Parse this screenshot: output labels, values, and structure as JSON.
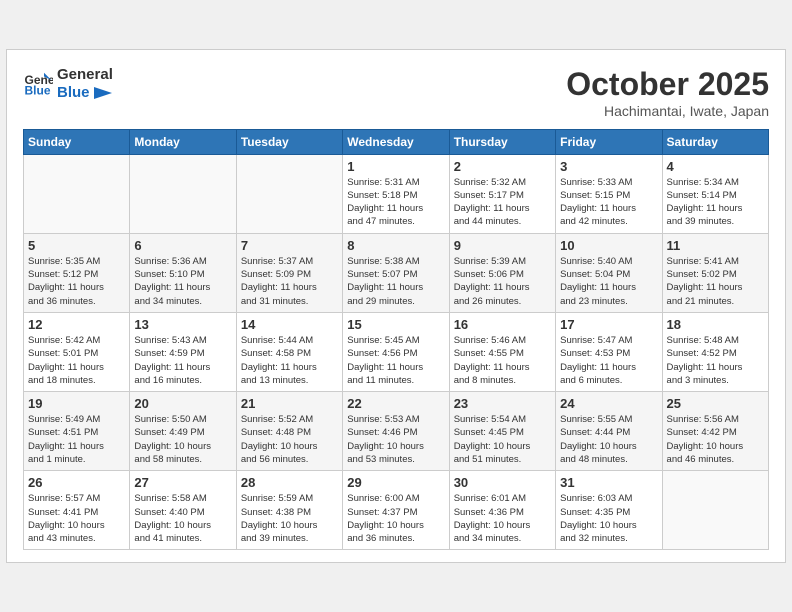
{
  "header": {
    "logo_line1": "General",
    "logo_line2": "Blue",
    "month_title": "October 2025",
    "location": "Hachimantai, Iwate, Japan"
  },
  "weekdays": [
    "Sunday",
    "Monday",
    "Tuesday",
    "Wednesday",
    "Thursday",
    "Friday",
    "Saturday"
  ],
  "weeks": [
    [
      {
        "day": "",
        "info": ""
      },
      {
        "day": "",
        "info": ""
      },
      {
        "day": "",
        "info": ""
      },
      {
        "day": "1",
        "info": "Sunrise: 5:31 AM\nSunset: 5:18 PM\nDaylight: 11 hours\nand 47 minutes."
      },
      {
        "day": "2",
        "info": "Sunrise: 5:32 AM\nSunset: 5:17 PM\nDaylight: 11 hours\nand 44 minutes."
      },
      {
        "day": "3",
        "info": "Sunrise: 5:33 AM\nSunset: 5:15 PM\nDaylight: 11 hours\nand 42 minutes."
      },
      {
        "day": "4",
        "info": "Sunrise: 5:34 AM\nSunset: 5:14 PM\nDaylight: 11 hours\nand 39 minutes."
      }
    ],
    [
      {
        "day": "5",
        "info": "Sunrise: 5:35 AM\nSunset: 5:12 PM\nDaylight: 11 hours\nand 36 minutes."
      },
      {
        "day": "6",
        "info": "Sunrise: 5:36 AM\nSunset: 5:10 PM\nDaylight: 11 hours\nand 34 minutes."
      },
      {
        "day": "7",
        "info": "Sunrise: 5:37 AM\nSunset: 5:09 PM\nDaylight: 11 hours\nand 31 minutes."
      },
      {
        "day": "8",
        "info": "Sunrise: 5:38 AM\nSunset: 5:07 PM\nDaylight: 11 hours\nand 29 minutes."
      },
      {
        "day": "9",
        "info": "Sunrise: 5:39 AM\nSunset: 5:06 PM\nDaylight: 11 hours\nand 26 minutes."
      },
      {
        "day": "10",
        "info": "Sunrise: 5:40 AM\nSunset: 5:04 PM\nDaylight: 11 hours\nand 23 minutes."
      },
      {
        "day": "11",
        "info": "Sunrise: 5:41 AM\nSunset: 5:02 PM\nDaylight: 11 hours\nand 21 minutes."
      }
    ],
    [
      {
        "day": "12",
        "info": "Sunrise: 5:42 AM\nSunset: 5:01 PM\nDaylight: 11 hours\nand 18 minutes."
      },
      {
        "day": "13",
        "info": "Sunrise: 5:43 AM\nSunset: 4:59 PM\nDaylight: 11 hours\nand 16 minutes."
      },
      {
        "day": "14",
        "info": "Sunrise: 5:44 AM\nSunset: 4:58 PM\nDaylight: 11 hours\nand 13 minutes."
      },
      {
        "day": "15",
        "info": "Sunrise: 5:45 AM\nSunset: 4:56 PM\nDaylight: 11 hours\nand 11 minutes."
      },
      {
        "day": "16",
        "info": "Sunrise: 5:46 AM\nSunset: 4:55 PM\nDaylight: 11 hours\nand 8 minutes."
      },
      {
        "day": "17",
        "info": "Sunrise: 5:47 AM\nSunset: 4:53 PM\nDaylight: 11 hours\nand 6 minutes."
      },
      {
        "day": "18",
        "info": "Sunrise: 5:48 AM\nSunset: 4:52 PM\nDaylight: 11 hours\nand 3 minutes."
      }
    ],
    [
      {
        "day": "19",
        "info": "Sunrise: 5:49 AM\nSunset: 4:51 PM\nDaylight: 11 hours\nand 1 minute."
      },
      {
        "day": "20",
        "info": "Sunrise: 5:50 AM\nSunset: 4:49 PM\nDaylight: 10 hours\nand 58 minutes."
      },
      {
        "day": "21",
        "info": "Sunrise: 5:52 AM\nSunset: 4:48 PM\nDaylight: 10 hours\nand 56 minutes."
      },
      {
        "day": "22",
        "info": "Sunrise: 5:53 AM\nSunset: 4:46 PM\nDaylight: 10 hours\nand 53 minutes."
      },
      {
        "day": "23",
        "info": "Sunrise: 5:54 AM\nSunset: 4:45 PM\nDaylight: 10 hours\nand 51 minutes."
      },
      {
        "day": "24",
        "info": "Sunrise: 5:55 AM\nSunset: 4:44 PM\nDaylight: 10 hours\nand 48 minutes."
      },
      {
        "day": "25",
        "info": "Sunrise: 5:56 AM\nSunset: 4:42 PM\nDaylight: 10 hours\nand 46 minutes."
      }
    ],
    [
      {
        "day": "26",
        "info": "Sunrise: 5:57 AM\nSunset: 4:41 PM\nDaylight: 10 hours\nand 43 minutes."
      },
      {
        "day": "27",
        "info": "Sunrise: 5:58 AM\nSunset: 4:40 PM\nDaylight: 10 hours\nand 41 minutes."
      },
      {
        "day": "28",
        "info": "Sunrise: 5:59 AM\nSunset: 4:38 PM\nDaylight: 10 hours\nand 39 minutes."
      },
      {
        "day": "29",
        "info": "Sunrise: 6:00 AM\nSunset: 4:37 PM\nDaylight: 10 hours\nand 36 minutes."
      },
      {
        "day": "30",
        "info": "Sunrise: 6:01 AM\nSunset: 4:36 PM\nDaylight: 10 hours\nand 34 minutes."
      },
      {
        "day": "31",
        "info": "Sunrise: 6:03 AM\nSunset: 4:35 PM\nDaylight: 10 hours\nand 32 minutes."
      },
      {
        "day": "",
        "info": ""
      }
    ]
  ]
}
